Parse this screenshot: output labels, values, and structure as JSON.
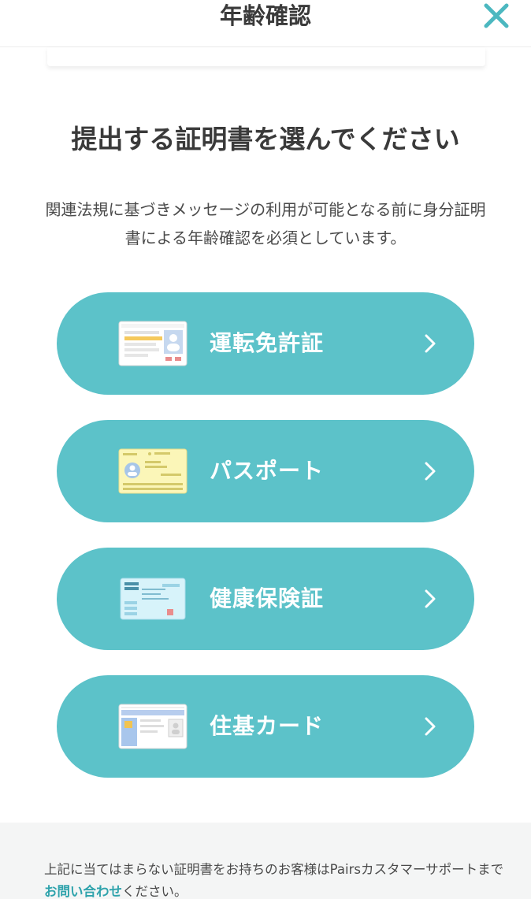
{
  "header": {
    "title": "年齢確認",
    "close_icon": "close-icon",
    "accent_color": "#5cc2c9"
  },
  "main": {
    "headline": "提出する証明書を選んでください",
    "description": "関連法規に基づきメッセージの利用が可能となる前に身分証明書による年齢確認を必須としています。",
    "options": [
      {
        "label": "運転免許証",
        "icon": "drivers-license-icon"
      },
      {
        "label": "パスポート",
        "icon": "passport-icon"
      },
      {
        "label": "健康保険証",
        "icon": "health-insurance-card-icon"
      },
      {
        "label": "住基カード",
        "icon": "resident-card-icon"
      }
    ],
    "option_color": "#5cc2c9"
  },
  "footer": {
    "text_before": "上記に当てはまらない証明書をお持ちのお客様はPairsカスタマーサポートまで",
    "link_text": "お問い合わせ",
    "text_after": "ください。",
    "link_color": "#2fa3ac"
  }
}
